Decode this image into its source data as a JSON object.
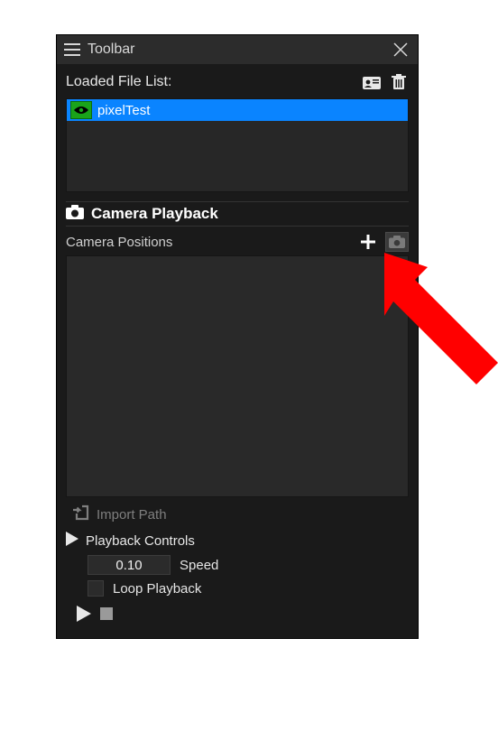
{
  "header": {
    "title": "Toolbar"
  },
  "fileList": {
    "label": "Loaded File List:",
    "items": [
      {
        "name": "pixelTest",
        "visible": true,
        "selected": true
      }
    ]
  },
  "cameraPlayback": {
    "title": "Camera Playback",
    "positions": {
      "label": "Camera Positions",
      "items": []
    },
    "importLabel": "Import Path",
    "controlsLabel": "Playback Controls",
    "speed": {
      "value": "0.10",
      "label": "Speed"
    },
    "loop": {
      "label": "Loop Playback",
      "checked": false
    }
  },
  "icons": {
    "menu": "menu-icon",
    "close": "close-icon",
    "idcard": "id-card-icon",
    "trash": "trash-icon",
    "eye": "eye-icon",
    "camera": "camera-icon",
    "plus": "plus-icon",
    "snapshot": "camera-icon",
    "import": "import-icon",
    "play": "play-icon",
    "stop": "stop-icon"
  }
}
